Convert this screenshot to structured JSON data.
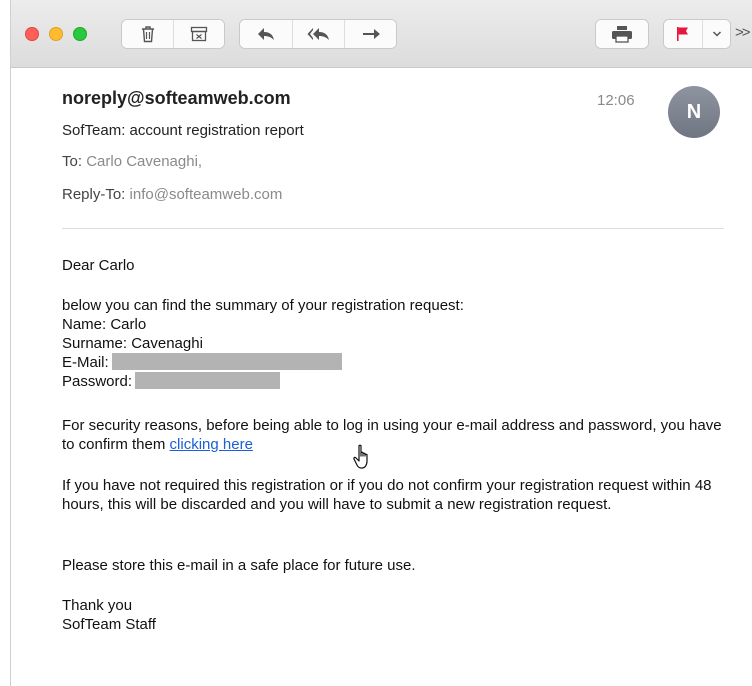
{
  "toolbar": {
    "icons": {
      "delete": "trash-icon",
      "archive": "archive-icon",
      "reply": "reply-icon",
      "reply_all": "reply-all-icon",
      "forward": "forward-icon",
      "print": "printer-icon",
      "flag": "flag-icon",
      "flag_menu": "chevron-down-icon",
      "overflow": "double-chevron-right-icon"
    },
    "overflow_glyph": ">>"
  },
  "message": {
    "from": "noreply@softeamweb.com",
    "time": "12:06",
    "avatar_initial": "N",
    "subject": "SofTeam: account registration report",
    "to_label": "To:",
    "to_value": "Carlo Cavenaghi,",
    "reply_to_label": "Reply-To:",
    "reply_to_value": "info@softeamweb.com"
  },
  "body": {
    "greeting": "Dear Carlo",
    "summary_intro": "below you can find the summary of your registration request:",
    "name_line": "Name: Carlo",
    "surname_line": "Surname: Cavenaghi",
    "email_label": "E-Mail:",
    "password_label": "Password:",
    "security_text": "For security reasons, before being able to log in using your e-mail address and password, you have to confirm them",
    "confirm_link": "clicking here",
    "not_required_text": "If you have not required this registration or if you do not confirm your registration request within 48 hours, this will be discarded and you will have to submit a new registration request.",
    "store_text": "Please store this e-mail in a safe place for future use.",
    "thanks_line": "Thank you",
    "signature": "SofTeam Staff"
  },
  "colors": {
    "link": "#1a5fd6",
    "flag": "#e5173c",
    "avatar": "#7b818d",
    "redaction": "#b3b3b3"
  }
}
